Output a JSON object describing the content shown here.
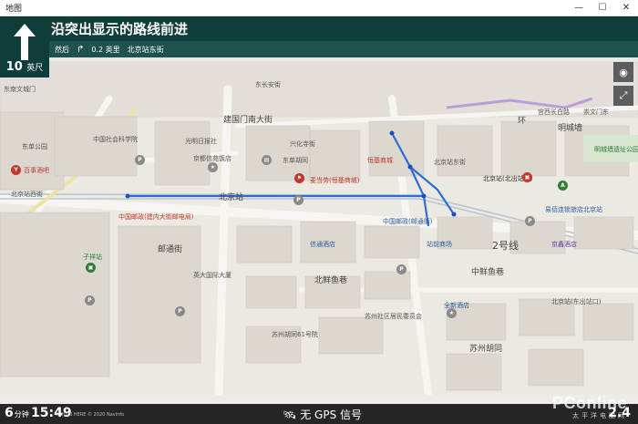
{
  "window": {
    "title": "地图"
  },
  "navigation": {
    "instruction": "沿突出显示的路线前进",
    "distance_value": "10",
    "distance_unit": "英尺",
    "then_label": "然后",
    "next_distance": "0.2 英里",
    "next_street": "北京站东街"
  },
  "map_labels": {
    "l1": "东南文城门",
    "l2": "建国门南大街",
    "l3": "中国社会科学院",
    "l4": "北京站",
    "l5": "北京站(北出站口)",
    "l6": "北京站东街",
    "l7": "北京站西街",
    "l8": "中国邮政(建内大街邮电局)",
    "l9": "邮通街",
    "l10": "英大国际大厦",
    "l11": "北鲜鱼巷",
    "l12": "苏州胡同61号院",
    "l13": "苏州社区居民委员会",
    "l14": "站前商场",
    "l15": "2号线",
    "l16": "中鲜鱼巷",
    "l17": "苏州胡同",
    "l18": "易佰连锁旅店北京站",
    "l19": "京鑫酒店",
    "l20": "麦当劳(恒基商城)",
    "l21": "恒基商城",
    "l22": "东单胡同",
    "l23": "明城墙遗址公园",
    "l24": "中国邮政(邮通街)",
    "l25": "信通酒店",
    "l26": "北京站(东出站口)",
    "l27": "子祥站",
    "l28": "全新酒店",
    "l29": "百事酒吧",
    "l30": "京都信苑饭店",
    "l31": "光明日报社",
    "l32": "东单公园",
    "l33": "明城墙",
    "l34": "宫西长白路",
    "l35": "兴化寺街",
    "l36": "东长安街",
    "l37": "崇文门东",
    "l38": "环"
  },
  "bottom": {
    "eta_minutes": "6",
    "eta_unit": "分钟",
    "arrival_time": "15:49",
    "copyright": "© 2020 HERE © 2020 Navinfo",
    "gps_status": "无 GPS 信号",
    "remaining": "2.4",
    "watermark_main": "PConline",
    "watermark_sub": "太平洋电脑网"
  },
  "colors": {
    "banner_dark": "#0f3d3a",
    "banner_sub": "#1e524e",
    "route": "#2b6fd6",
    "bottom_bar": "#262626"
  },
  "icons": {
    "straight": "straight-arrow-icon",
    "turn": "turn-right-icon",
    "location": "locate-icon",
    "expand": "expand-icon",
    "gps": "satellite-icon"
  }
}
